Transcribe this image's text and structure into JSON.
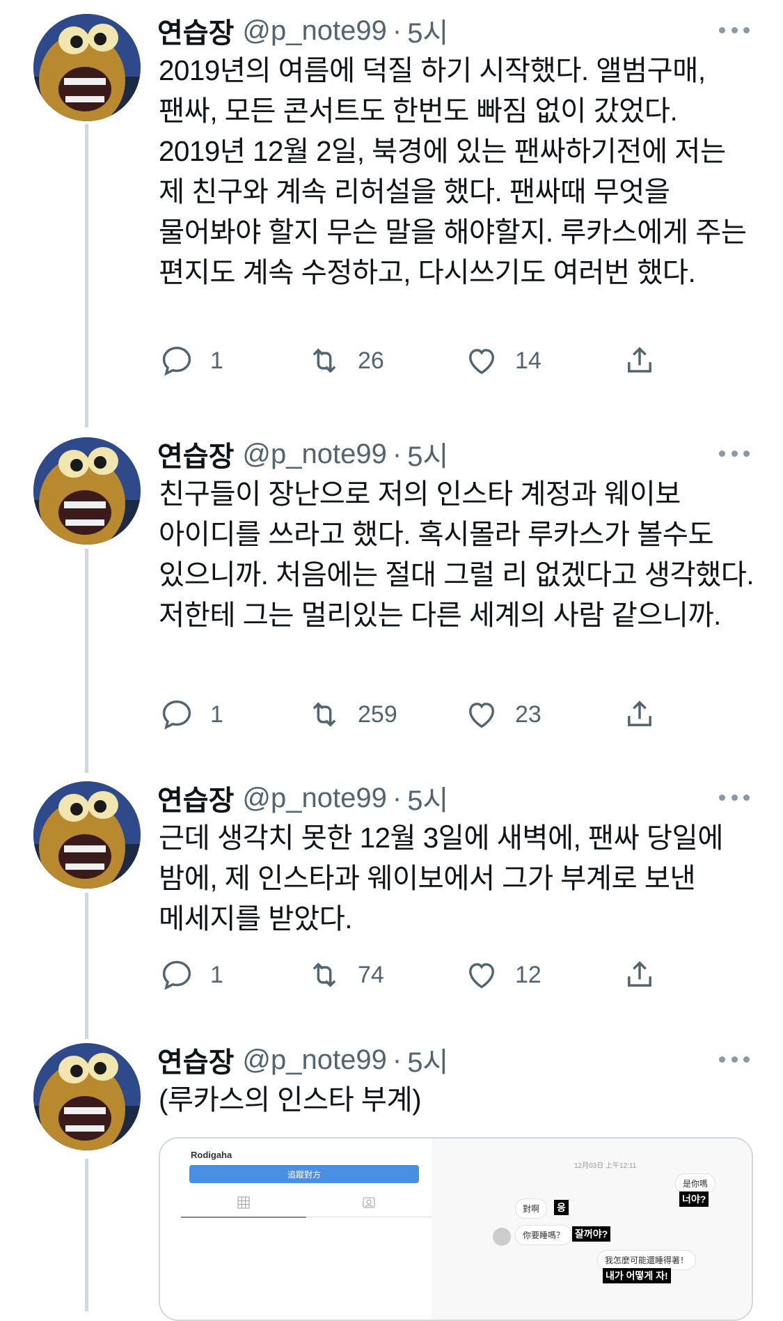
{
  "tweets": [
    {
      "name": "연습장",
      "handle": "@p_note99",
      "dot": "·",
      "time": "5시",
      "text": "2019년의 여름에 덕질 하기 시작했다. 앨범구매, 팬싸, 모든 콘서트도 한번도 빠짐 없이 갔었다. 2019년 12월 2일, 북경에 있는 팬싸하기전에 저는 제 친구와 계속 리허설을 했다. 팬싸때 무엇을 물어봐야 할지 무슨 말을 해야할지. 루카스에게 주는 편지도 계속 수정하고, 다시쓰기도 여러번 했다.",
      "replies": "1",
      "retweets": "26",
      "likes": "14"
    },
    {
      "name": "연습장",
      "handle": "@p_note99",
      "dot": "·",
      "time": "5시",
      "text": "친구들이 장난으로 저의 인스타 계정과 웨이보 아이디를 쓰라고 했다. 혹시몰라 루카스가 볼수도 있으니까. 처음에는 절대 그럴 리 없겠다고 생각했다. 저한테 그는 멀리있는 다른 세계의 사람 같으니까.",
      "replies": "1",
      "retweets": "259",
      "likes": "23"
    },
    {
      "name": "연습장",
      "handle": "@p_note99",
      "dot": "·",
      "time": "5시",
      "text": "근데 생각치 못한 12월 3일에 새벽에, 팬싸 당일에 밤에, 제 인스타과 웨이보에서 그가 부계로 보낸 메세지를 받았다.",
      "replies": "1",
      "retweets": "74",
      "likes": "12"
    },
    {
      "name": "연습장",
      "handle": "@p_note99",
      "dot": "·",
      "time": "5시",
      "text": "(루카스의 인스타 부계)"
    }
  ],
  "media": {
    "profile_name": "Rodigaha",
    "follow_label": "追蹤對方",
    "dm_timestamp": "12月03日 上午12:11",
    "messages": [
      {
        "text": "是你嗎",
        "caption": "너야?"
      },
      {
        "text": "對啊",
        "caption": "응"
      },
      {
        "text": "你要睡嗎？",
        "caption": "잘꺼야?"
      },
      {
        "text": "我怎麼可能還睡得著！",
        "caption": "내가 어떻게 자!"
      }
    ]
  },
  "icons": {
    "reply": "reply-icon",
    "retweet": "retweet-icon",
    "like": "heart-icon",
    "share": "share-icon",
    "more": "more-icon"
  },
  "colors": {
    "text": "#0f1419",
    "secondary": "#536471",
    "thread_line": "#cfd9de"
  }
}
